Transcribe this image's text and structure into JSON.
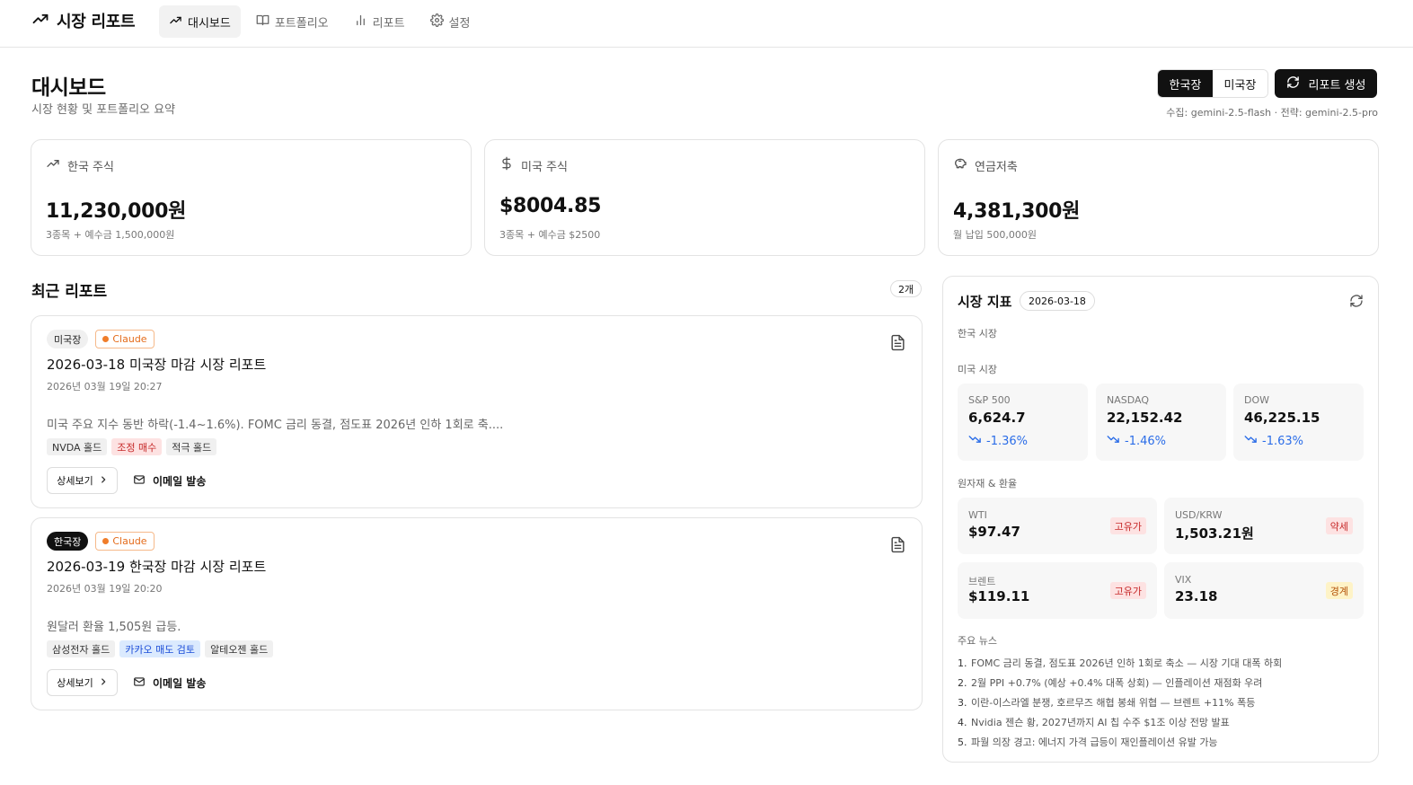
{
  "app": {
    "title": "시장 리포트",
    "brand_icon": "trend-up-icon"
  },
  "nav": [
    {
      "label": "대시보드",
      "icon": "trend-up-icon",
      "active": true
    },
    {
      "label": "포트폴리오",
      "icon": "book-icon",
      "active": false
    },
    {
      "label": "리포트",
      "icon": "bar-chart-icon",
      "active": false
    },
    {
      "label": "설정",
      "icon": "gear-icon",
      "active": false
    }
  ],
  "header": {
    "title": "대시보드",
    "subtitle": "시장 현황 및 포트폴리오 요약",
    "market_toggle": {
      "options": [
        "한국장",
        "미국장"
      ],
      "selected": "한국장"
    },
    "generate_label": "리포트 생성",
    "model_info": "수집: gemini-2.5-flash · 전략: gemini-2.5-pro"
  },
  "summary": [
    {
      "label": "한국 주식",
      "icon": "trend-up-icon",
      "value": "11,230,000원",
      "note": "3종목 + 예수금 1,500,000원"
    },
    {
      "label": "미국 주식",
      "icon": "dollar-icon",
      "value": "$8004.85",
      "note": "3종목 + 예수금 $2500"
    },
    {
      "label": "연금저축",
      "icon": "piggy-bank-icon",
      "value": "4,381,300원",
      "note": "월 납입 500,000원"
    }
  ],
  "reports": {
    "title": "최근 리포트",
    "count": "2개",
    "detail_label": "상세보기",
    "email_label": "이메일 발송",
    "items": [
      {
        "market": "미국장",
        "model": "Claude",
        "title": "2026-03-18 미국장 마감 시장 리포트",
        "date": "2026년 03월 19일 20:27",
        "summary": "미국 주요 지수 동반 하락(-1.4~1.6%). FOMC 금리 동결, 점도표 2026년 인하 1회로 축....",
        "tags": [
          {
            "label": "NVDA 홀드",
            "tone": "gray"
          },
          {
            "label": "조정 매수",
            "tone": "red"
          },
          {
            "label": "적극 홀드",
            "tone": "gray"
          }
        ]
      },
      {
        "market": "한국장",
        "model": "Claude",
        "title": "2026-03-19 한국장 마감 시장 리포트",
        "date": "2026년 03월 19일 20:20",
        "summary": "원달러 환율 1,505원 급등.",
        "tags": [
          {
            "label": "삼성전자 홀드",
            "tone": "gray"
          },
          {
            "label": "카카오 매도 검토",
            "tone": "blue"
          },
          {
            "label": "알테오젠 홀드",
            "tone": "gray"
          }
        ]
      }
    ]
  },
  "market": {
    "title": "시장 지표",
    "date": "2026-03-18",
    "kr_label": "한국 시장",
    "us_label": "미국 시장",
    "indices": [
      {
        "name": "S&P 500",
        "value": "6,624.7",
        "change": "-1.36%"
      },
      {
        "name": "NASDAQ",
        "value": "22,152.42",
        "change": "-1.46%"
      },
      {
        "name": "DOW",
        "value": "46,225.15",
        "change": "-1.63%"
      }
    ],
    "commodity_label": "원자재 & 환율",
    "commodities": [
      {
        "name": "WTI",
        "value": "$97.47",
        "status": "고유가",
        "tone": "red"
      },
      {
        "name": "USD/KRW",
        "value": "1,503.21원",
        "status": "약세",
        "tone": "red"
      },
      {
        "name": "브렌트",
        "value": "$119.11",
        "status": "고유가",
        "tone": "red"
      },
      {
        "name": "VIX",
        "value": "23.18",
        "status": "경계",
        "tone": "yellow"
      }
    ],
    "news_label": "주요 뉴스",
    "news": [
      {
        "num": "1.",
        "text": "FOMC 금리 동결, 점도표 2026년 인하 1회로 축소 — 시장 기대 대폭 하회"
      },
      {
        "num": "2.",
        "text": "2월 PPI +0.7% (예상 +0.4% 대폭 상회) — 인플레이션 재점화 우려"
      },
      {
        "num": "3.",
        "text": "이란-이스라엘 분쟁, 호르무즈 해협 봉쇄 위협 — 브렌트 +11% 폭등"
      },
      {
        "num": "4.",
        "text": "Nvidia 젠슨 황, 2027년까지 AI 칩 수주 $1조 이상 전망 발표"
      },
      {
        "num": "5.",
        "text": "파월 의장 경고: 에너지 가격 급등이 재인플레이션 유발 가능"
      }
    ]
  }
}
